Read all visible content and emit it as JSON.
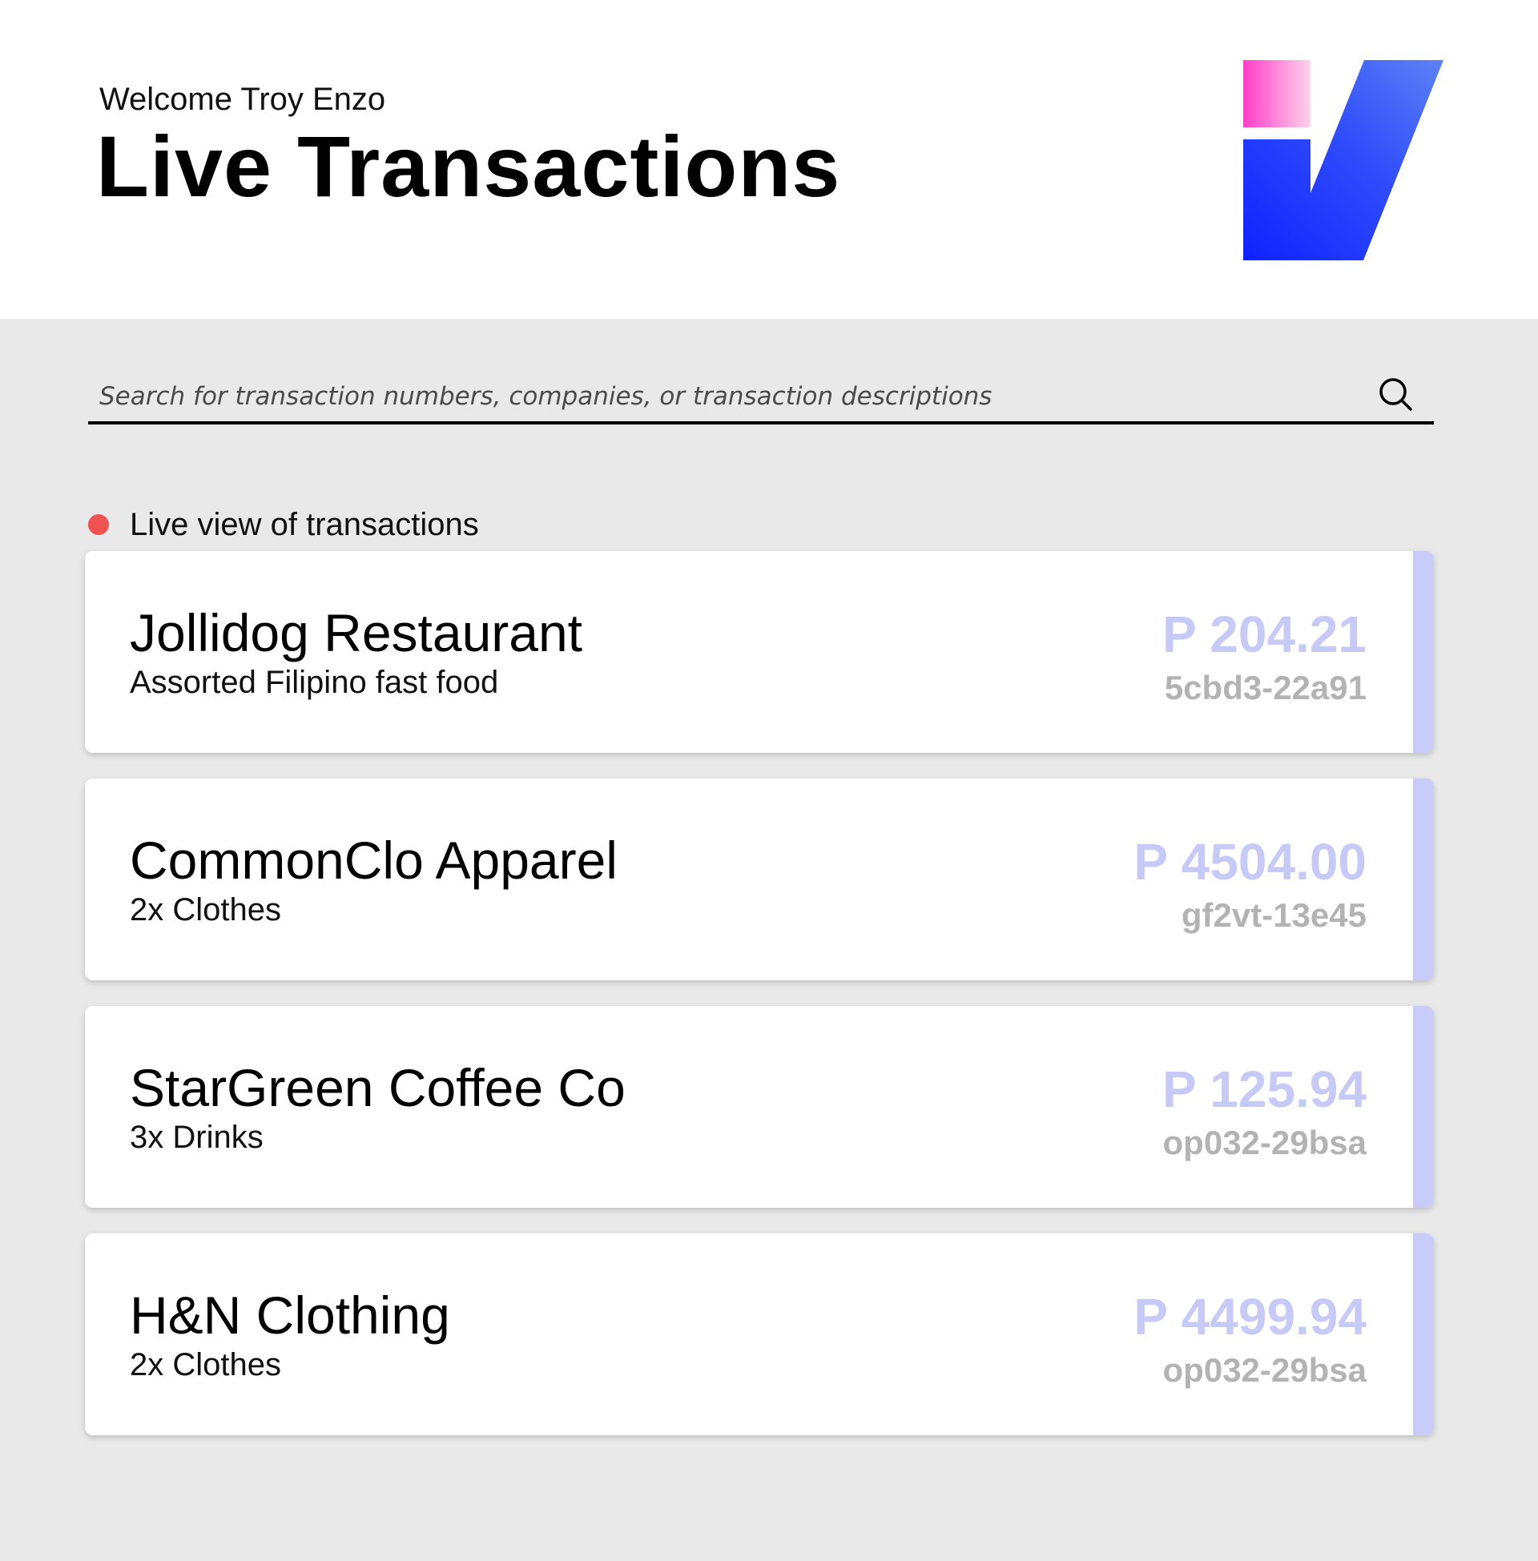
{
  "header": {
    "welcome": "Welcome Troy Enzo",
    "title": "Live Transactions",
    "logo_icon": "brand-logo-icon"
  },
  "search": {
    "placeholder": "Search for transaction numbers, companies, or transaction descriptions",
    "value": "",
    "icon": "search-icon"
  },
  "live": {
    "label": "Live view of transactions",
    "indicator_color": "#f05252"
  },
  "colors": {
    "amount": "#c7c9f7",
    "transaction_id": "#b3b3b3",
    "card_accent": "#c9cbf8",
    "logo_pink": "#ff3ec9",
    "logo_blue": "#1022ff",
    "logo_blue_light": "#5c82f5"
  },
  "transactions": [
    {
      "company": "Jollidog Restaurant",
      "description": "Assorted Filipino fast food",
      "amount": "P 204.21",
      "id": "5cbd3-22a91"
    },
    {
      "company": "CommonClo Apparel",
      "description": "2x Clothes",
      "amount": "P 4504.00",
      "id": "gf2vt-13e45"
    },
    {
      "company": "StarGreen Coffee Co",
      "description": "3x Drinks",
      "amount": "P 125.94",
      "id": "op032-29bsa"
    },
    {
      "company": "H&N Clothing",
      "description": "2x Clothes",
      "amount": "P 4499.94",
      "id": "op032-29bsa"
    }
  ]
}
